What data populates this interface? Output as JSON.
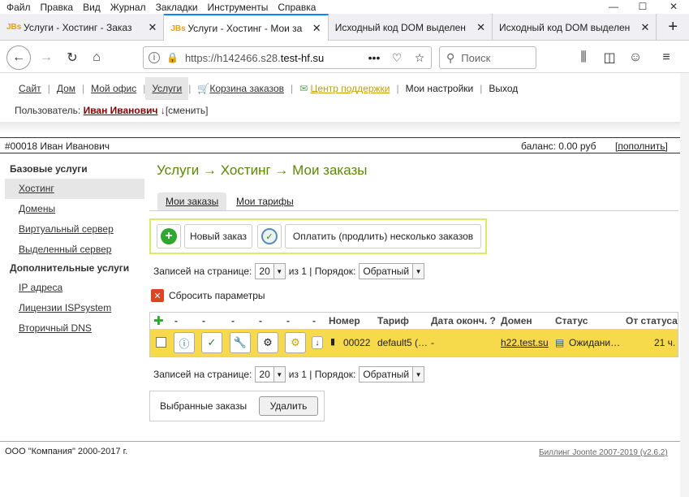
{
  "menu": [
    "Файл",
    "Правка",
    "Вид",
    "Журнал",
    "Закладки",
    "Инструменты",
    "Справка"
  ],
  "window_controls": {
    "minimize": "—",
    "maximize": "☐",
    "close": "✕"
  },
  "tabs": [
    {
      "favicon": "JBs",
      "title": "Услуги - Хостинг - Заказ",
      "close": "✕"
    },
    {
      "favicon": "JBs",
      "title": "Услуги - Хостинг - Мои за",
      "close": "✕"
    },
    {
      "favicon": "",
      "title": "Исходный код DOM выделен",
      "close": "✕"
    },
    {
      "favicon": "",
      "title": "Исходный код DOM выделен",
      "close": "✕"
    }
  ],
  "new_tab": "+",
  "url": {
    "prefix": "https://h142466.s28.",
    "host": "test-hf.su",
    "more": "•••"
  },
  "search_placeholder": "Поиск",
  "sitenav": [
    "Сайт",
    "Дом",
    "Мой офис",
    "Услуги",
    "Корзина заказов",
    "Центр поддержки",
    "Мои настройки",
    "Выход"
  ],
  "user": {
    "label": "Пользователь:",
    "name": "Иван Иванович",
    "change": "↓[сменить]"
  },
  "account": {
    "id_name": "#00018   Иван Иванович",
    "balance": "баланс: 0.00 руб",
    "topup": "[пополнить]"
  },
  "sidebar": {
    "h1": "Базовые услуги",
    "items1": [
      "Хостинг",
      "Домены",
      "Виртуальный сервер",
      "Выделенный сервер"
    ],
    "h2": "Дополнительные услуги",
    "items2": [
      "IP адреса",
      "Лицензии ISPsystem",
      "Вторичный DNS"
    ]
  },
  "page_title": "Услуги → Хостинг → Мои заказы",
  "subtabs": [
    "Мои заказы",
    "Мои тарифы"
  ],
  "actions": {
    "new_order": "Новый заказ",
    "pay_many": "Оплатить (продлить) несколько заказов"
  },
  "perpage": {
    "label": "Записей на странице:",
    "value": "20",
    "of": "из 1 | Порядок:",
    "order": "Обратный"
  },
  "reset": "Сбросить параметры",
  "table": {
    "headers": [
      "-",
      "-",
      "-",
      "-",
      "-",
      "-",
      "Номер",
      "Тариф",
      "Дата оконч. ?",
      "Домен",
      "Статус",
      "От статуса"
    ],
    "row": {
      "number": "00022",
      "tariff": "default5 (…",
      "date": "-",
      "domain": "h22.test.su",
      "status": "Ожидани…",
      "since": "21 ч."
    }
  },
  "selected": {
    "label": "Выбранные заказы",
    "delete": "Удалить"
  },
  "footer": {
    "left": "ООО \"Компания\" 2000-2017 г.",
    "right": "Биллинг Joonte 2007-2019 (v2.6.2)"
  }
}
